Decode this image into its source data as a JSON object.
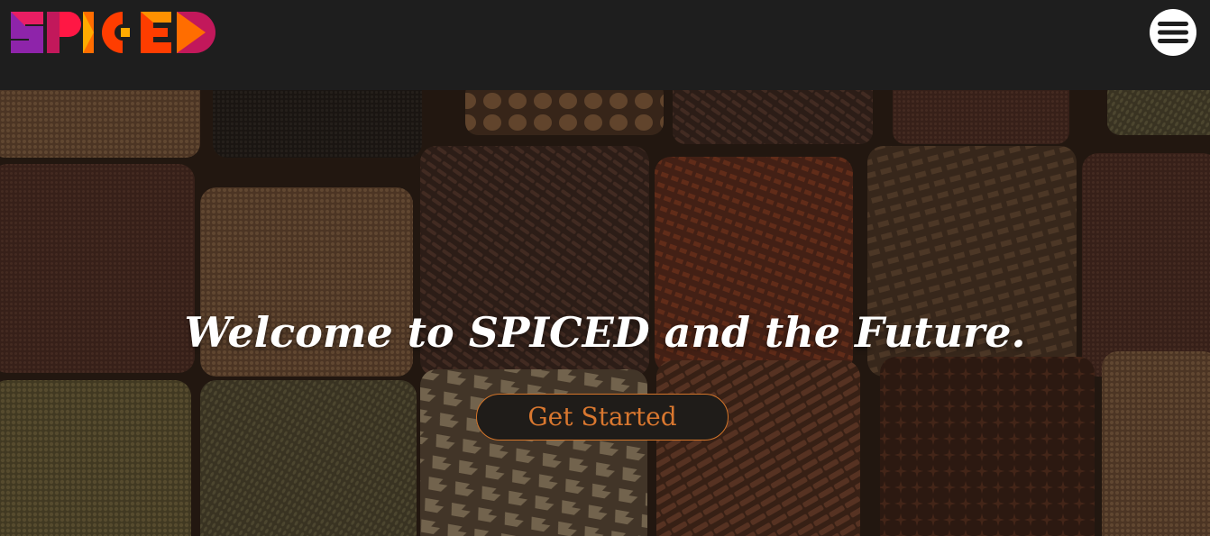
{
  "header": {
    "logo_text": "SPICED",
    "menu_icon": "hamburger-icon",
    "logo_colors": [
      "#7b1fa2",
      "#e91e63",
      "#ff3d00",
      "#ff9100",
      "#c2185b"
    ]
  },
  "hero": {
    "title": "Welcome to SPICED and the Future.",
    "cta_label": "Get Started",
    "accent_color": "#d9772f",
    "background_image": "spice-market-sacks"
  }
}
